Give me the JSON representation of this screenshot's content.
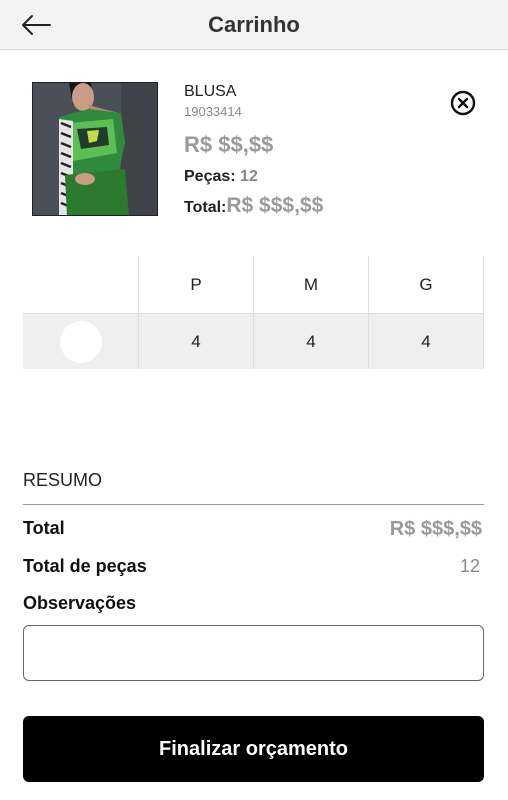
{
  "appbar": {
    "title": "Carrinho",
    "back_icon": "arrow-left-icon"
  },
  "product": {
    "name": "BLUSA",
    "code": "19033414",
    "price": "R$ $$,$$",
    "qty_label": "Peças:",
    "qty_value": "12",
    "total_label": "Total:",
    "total_value": "R$ $$$,$$",
    "remove_icon": "close-circle-icon"
  },
  "sizes": {
    "headers": [
      "P",
      "M",
      "G"
    ],
    "quantities": [
      "4",
      "4",
      "4"
    ]
  },
  "summary": {
    "title": "RESUMO",
    "total_label": "Total",
    "total_value": "R$ $$$,$$",
    "pieces_label": "Total de peças",
    "pieces_value": "12",
    "notes_label": "Observações",
    "notes_value": ""
  },
  "actions": {
    "finish_label": "Finalizar orçamento"
  },
  "colors": {
    "button_bg": "#000000",
    "appbar_bg": "#f3f3f3",
    "muted_price": "#9a9a9a"
  }
}
